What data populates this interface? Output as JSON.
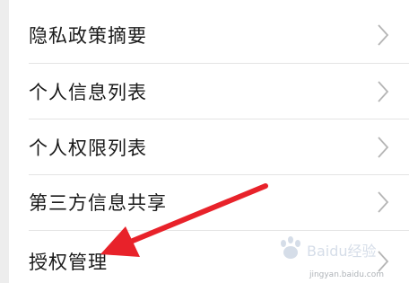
{
  "settings_list": {
    "items": [
      {
        "label": "隐私政策摘要"
      },
      {
        "label": "个人信息列表"
      },
      {
        "label": "个人权限列表"
      },
      {
        "label": "第三方信息共享"
      },
      {
        "label": "授权管理"
      }
    ]
  },
  "annotation": {
    "arrow_color": "#e8222a"
  },
  "watermark": {
    "logo_text": "Baidu经验",
    "url_text": "jingyan.baidu.com"
  }
}
